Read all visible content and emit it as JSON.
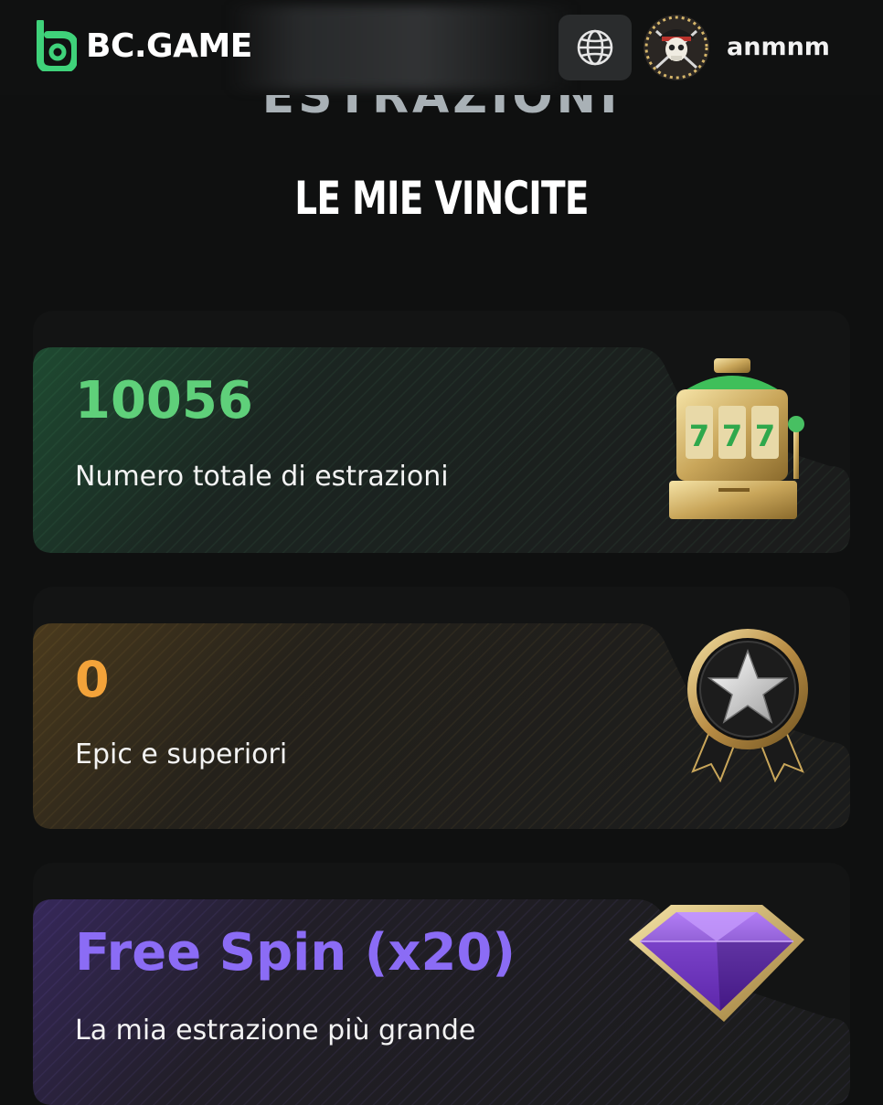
{
  "header": {
    "brand": "BC.GAME",
    "username": "anmnm",
    "icons": {
      "logo": "bc-logo-icon",
      "language": "globe-icon",
      "avatar": "pirate-skull-avatar"
    }
  },
  "page": {
    "section_title": "ESTRAZIONI",
    "heading": "LE MIE VINCITE"
  },
  "stats": [
    {
      "value": "10056",
      "label": "Numero totale di estrazioni",
      "accent": "#5fd07a",
      "icon": "slot-machine-icon"
    },
    {
      "value": "0",
      "label": "Epic e superiori",
      "accent": "#f3a33a",
      "icon": "star-medal-icon"
    },
    {
      "value": "Free Spin (x20)",
      "label": "La mia estrazione più grande",
      "accent": "#8b6cf5",
      "icon": "purple-diamond-icon"
    }
  ],
  "colors": {
    "background": "#0f1010",
    "card": "#1a1b1b",
    "brand_green": "#4fd47a"
  }
}
